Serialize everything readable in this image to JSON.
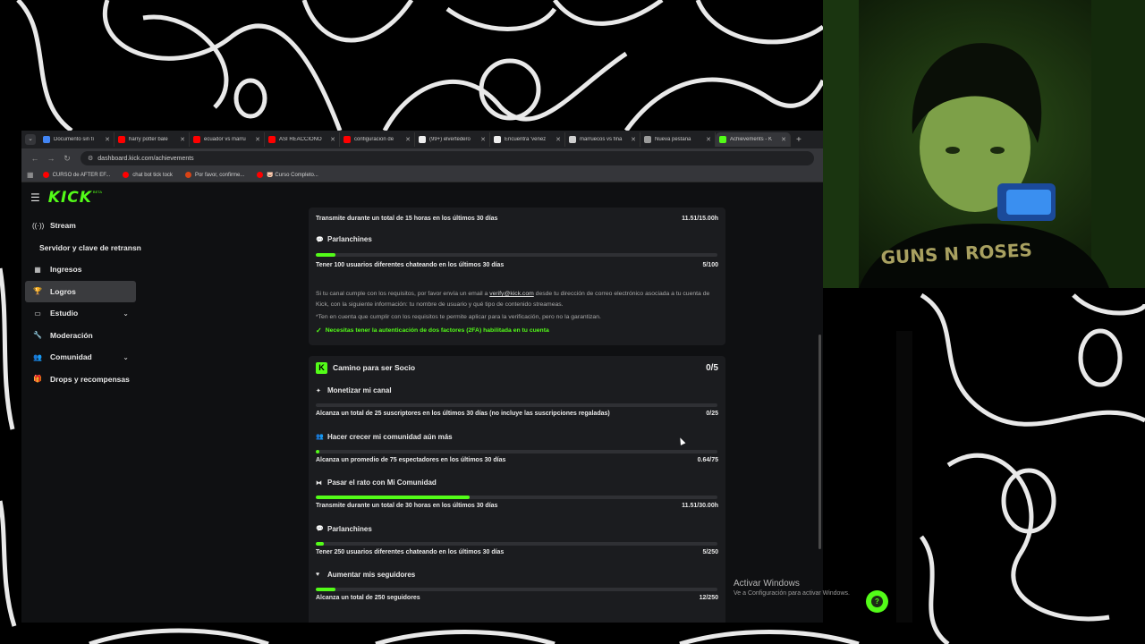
{
  "browser": {
    "tabs": [
      {
        "title": "Documento sin tí",
        "favicon": "docs-icon",
        "color": "#4285f4",
        "active": false
      },
      {
        "title": "harry potter bale",
        "favicon": "youtube-icon",
        "color": "#ff0000",
        "active": false
      },
      {
        "title": "ecuador vs marru",
        "favicon": "youtube-icon",
        "color": "#ff0000",
        "active": false
      },
      {
        "title": "ASÍ REACCIONÓ",
        "favicon": "youtube-icon",
        "color": "#ff0000",
        "active": false
      },
      {
        "title": "configuracion de",
        "favicon": "youtube-icon",
        "color": "#ff0000",
        "active": false
      },
      {
        "title": "(99+) elvertedero",
        "favicon": "tiktok-icon",
        "color": "#eeeeee",
        "active": false
      },
      {
        "title": "Encuentra 'venez",
        "favicon": "tiktok-icon",
        "color": "#eeeeee",
        "active": false
      },
      {
        "title": "marruecos vs fina",
        "favicon": "google-icon",
        "color": "#cfcfcf",
        "active": false
      },
      {
        "title": "Nueva pestaña",
        "favicon": "chrome-icon",
        "color": "#9a9a9a",
        "active": false
      },
      {
        "title": "Achievements - K",
        "favicon": "kick-icon",
        "color": "#53fc18",
        "active": true
      }
    ],
    "url": "dashboard.kick.com/achievements",
    "bookmarks": [
      {
        "label": "CURSO de AFTER EF...",
        "color": "#ff0000"
      },
      {
        "label": "chat bot tick tock",
        "color": "#ff0000"
      },
      {
        "label": "Por favor, confirme...",
        "color": "#d84315"
      },
      {
        "label": "🐷 Curso Completo...",
        "color": "#ff0000"
      }
    ]
  },
  "kick": {
    "logo": "KICK",
    "logo_badge": "BETA",
    "accent": "#53fc18",
    "sidebar": [
      {
        "label": "Stream",
        "icon": "broadcast-icon",
        "glyph": "((·))",
        "active": false,
        "chevron": false,
        "sub": false
      },
      {
        "label": "Servidor y clave de retransn",
        "icon": "",
        "glyph": "",
        "active": false,
        "chevron": false,
        "sub": true
      },
      {
        "label": "Ingresos",
        "icon": "chart-icon",
        "glyph": "▦",
        "active": false,
        "chevron": false,
        "sub": false
      },
      {
        "label": "Logros",
        "icon": "trophy-icon",
        "glyph": "🏆",
        "active": true,
        "chevron": false,
        "sub": false
      },
      {
        "label": "Estudio",
        "icon": "monitor-icon",
        "glyph": "▭",
        "active": false,
        "chevron": true,
        "sub": false
      },
      {
        "label": "Moderación",
        "icon": "wrench-icon",
        "glyph": "🔧",
        "active": false,
        "chevron": false,
        "sub": false
      },
      {
        "label": "Comunidad",
        "icon": "users-icon",
        "glyph": "👥",
        "active": false,
        "chevron": true,
        "sub": false
      },
      {
        "label": "Drops y recompensas",
        "icon": "gift-icon",
        "glyph": "🎁",
        "active": false,
        "chevron": false,
        "sub": false
      }
    ],
    "verification": {
      "top_row": {
        "text": "Transmite durante un total de 15 horas en los últimos 30 días",
        "value": "11.51/15.00h"
      },
      "chatters": {
        "title": "Parlanchines",
        "progress": 0.05,
        "text": "Tener 100 usuarios diferentes chateando en los últimos 30 días",
        "value": "5/100"
      },
      "info_pre": "Si tu canal cumple con los requisitos, por favor envía un email a ",
      "info_email": "verify@kick.com",
      "info_post": " desde tu dirección de correo electrónico asociada a tu cuenta de Kick, con la siguiente información: tu nombre de usuario y qué tipo de contenido streameas.",
      "note": "*Ten en cuenta que cumplir con los requisitos te permite aplicar para la verificación, pero no la garantizan.",
      "warning": "Necesitas tener la autenticación de dos factores (2FA) habilitada en tu cuenta"
    },
    "partner": {
      "title": "Camino para ser Socio",
      "count": "0/5",
      "goals": [
        {
          "title": "Monetizar mi canal",
          "icon": "sparkle-icon",
          "glyph": "✦",
          "progress": 0.0,
          "text": "Alcanza un total de 25 suscriptores en los últimos 30 días (no incluye las suscripciones regaladas)",
          "value": "0/25"
        },
        {
          "title": "Hacer crecer mi comunidad aún más",
          "icon": "users-icon",
          "glyph": "👥",
          "progress": 0.0085,
          "text": "Alcanza un promedio de 75 espectadores en los últimos 30 días",
          "value": "0.64/75"
        },
        {
          "title": "Pasar el rato con Mi Comunidad",
          "icon": "controller-icon",
          "glyph": "⧓",
          "progress": 0.3837,
          "text": "Transmite durante un total de 30 horas en los últimos 30 días",
          "value": "11.51/30.00h"
        },
        {
          "title": "Parlanchines",
          "icon": "chat-icon",
          "glyph": "💬",
          "progress": 0.02,
          "text": "Tener 250 usuarios diferentes chateando en los últimos 30 días",
          "value": "5/250"
        },
        {
          "title": "Aumentar mis seguidores",
          "icon": "heart-icon",
          "glyph": "♥",
          "progress": 0.048,
          "text": "Alcanza un total de 250 seguidores",
          "value": "12/250"
        }
      ]
    }
  },
  "windows": {
    "activate_title": "Activar Windows",
    "activate_sub": "Ve a Configuración para activar Windows."
  }
}
